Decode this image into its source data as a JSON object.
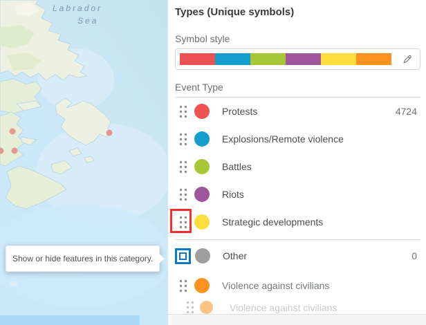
{
  "map": {
    "sea_label_line1": "Labrador",
    "sea_label_line2": "Sea",
    "dot_color": "#e48a8a",
    "water_color": "#cbe7f7",
    "deep_water_color": "#c2e1ee",
    "land_color": "#eef0e1",
    "bottom_bar_color": "#a9daf6"
  },
  "tooltip": {
    "text": "Show or hide features in this category."
  },
  "panel": {
    "title": "Types (Unique symbols)",
    "symbol_style_label": "Symbol style",
    "ramp_colors": [
      "#ed5151",
      "#149ece",
      "#a7c636",
      "#9e559c",
      "#ffde3e",
      "#fc921f"
    ],
    "list_header": "Event Type",
    "highlight_color": "#f5302c",
    "focus_color": "#0b79c2",
    "rows": [
      {
        "label": "Protests",
        "color": "#ed5151",
        "count": "4724",
        "style": "normal"
      },
      {
        "label": "Explosions/Remote violence",
        "color": "#149ece",
        "count": "",
        "style": "normal"
      },
      {
        "label": "Battles",
        "color": "#a7c636",
        "count": "",
        "style": "normal"
      },
      {
        "label": "Riots",
        "color": "#9e559c",
        "count": "",
        "style": "normal"
      },
      {
        "label": "Strategic developments",
        "color": "#ffde3e",
        "count": "",
        "style": "highlighted-handle"
      },
      {
        "label": "Other",
        "color": "#9e9e9e",
        "count": "0",
        "style": "checkbox-focused"
      },
      {
        "label": "Violence against civilians",
        "color": "#fc921f",
        "count": "",
        "style": "dragging-source"
      },
      {
        "label": "Violence against civilians",
        "color": "#fc921f",
        "count": "",
        "style": "drag-ghost"
      }
    ]
  }
}
